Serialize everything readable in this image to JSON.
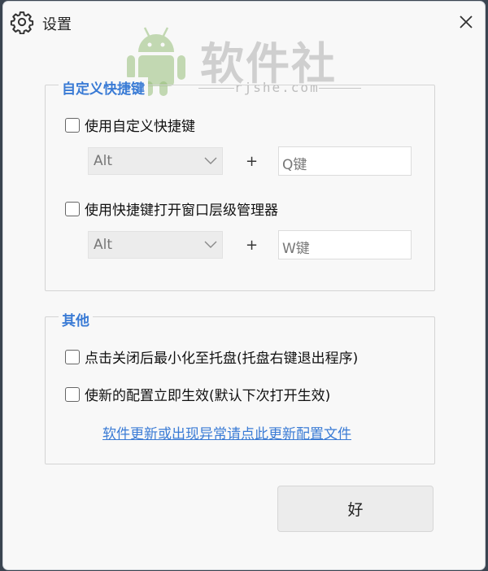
{
  "window": {
    "title": "设置",
    "icon": "gear-icon",
    "close_icon": "close-icon"
  },
  "watermark": {
    "text": "软件社",
    "sub": "rjshe.com",
    "icon": "android-icon"
  },
  "shortcut_group": {
    "legend": "自定义快捷键",
    "option1": {
      "label": "使用自定义快捷键",
      "checked": false,
      "modifier": "Alt",
      "plus": "+",
      "key": "Q键"
    },
    "option2": {
      "label": "使用快捷键打开窗口层级管理器",
      "checked": false,
      "modifier": "Alt",
      "plus": "+",
      "key": "W键"
    }
  },
  "other_group": {
    "legend": "其他",
    "minimize_label": "点击关闭后最小化至托盘(托盘右键退出程序)",
    "minimize_checked": false,
    "apply_label": "使新的配置立即生效(默认下次打开生效)",
    "apply_checked": false,
    "update_link": "软件更新或出现异常请点此更新配置文件"
  },
  "buttons": {
    "ok": "好"
  },
  "colors": {
    "accent": "#3a7bd5",
    "background": "#f8f8f8"
  }
}
